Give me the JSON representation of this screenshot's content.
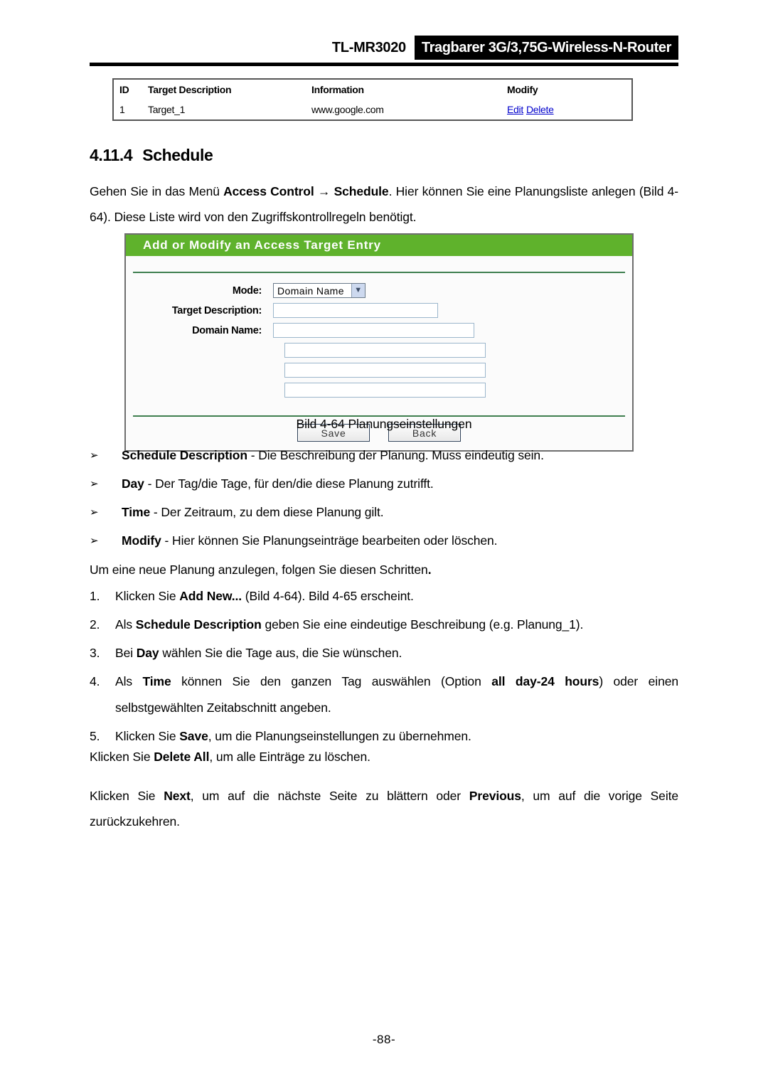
{
  "header": {
    "model": "TL-MR3020",
    "product": "Tragbarer 3G/3,75G-Wireless-N-Router"
  },
  "target_table": {
    "columns": [
      "ID",
      "Target Description",
      "Information",
      "Modify"
    ],
    "rows": [
      {
        "id": "1",
        "description": "Target_1",
        "information": "www.google.com",
        "edit_label": "Edit",
        "delete_label": "Delete"
      }
    ],
    "link_color": "#0000cc"
  },
  "section": {
    "number": "4.11.4",
    "title": "Schedule"
  },
  "intro": {
    "part1": "Gehen Sie in das Menü ",
    "bold1": "Access Control",
    "arrow": " → ",
    "bold2": "Schedule",
    "part2": ". Hier können Sie eine Planungsliste anlegen (Bild 4-64). Diese Liste wird von den Zugriffskontrollregeln benötigt."
  },
  "router_panel": {
    "title": "Add or Modify an Access Target Entry",
    "accent_color": "#5fb22c",
    "divider_color": "#3f7f4f",
    "fields": {
      "mode_label": "Mode:",
      "mode_value": "Domain Name",
      "mode_arrow": "▼",
      "target_description_label": "Target Description:",
      "target_description_value": "",
      "domain_name_label": "Domain Name:",
      "domain_name_value_1": "",
      "domain_name_value_2": "",
      "domain_name_value_3": "",
      "domain_name_value_4": ""
    },
    "buttons": {
      "save": "Save",
      "back": "Back"
    }
  },
  "caption": "Bild 4-64 Planungseinstellungen",
  "bullets": [
    {
      "glyph": "➢",
      "bold": "Schedule Description",
      "text": " - Die Beschreibung der Planung. Muss eindeutig sein."
    },
    {
      "glyph": "➢",
      "bold": "Day",
      "text": " - Der Tag/die Tage, für den/die diese Planung zutrifft."
    },
    {
      "glyph": "➢",
      "bold": "Time",
      "text": " - Der Zeitraum, zu dem diese Planung gilt."
    },
    {
      "glyph": "➢",
      "bold": "Modify",
      "text": " - Hier können Sie Planungseinträge bearbeiten oder löschen."
    }
  ],
  "mid_paragraph": {
    "text": "Um eine neue Planung anzulegen, folgen Sie diesen Schritten",
    "period": "."
  },
  "steps": [
    {
      "num": "1.",
      "pre": "Klicken Sie ",
      "bold": "Add New...",
      "post": " (Bild 4-64). Bild 4-65 erscheint."
    },
    {
      "num": "2.",
      "pre": "Als ",
      "bold": "Schedule Description",
      "post": " geben Sie eine eindeutige Beschreibung (e.g. Planung_1)."
    },
    {
      "num": "3.",
      "pre": "Bei ",
      "bold": "Day",
      "post": " wählen Sie die Tage aus, die Sie wünschen."
    },
    {
      "num": "4.",
      "pre": "Als ",
      "bold": "Time",
      "post": " können Sie den ganzen Tag auswählen (Option ",
      "bold2": "all day-24 hours",
      "post2": ") oder einen selbstgewählten Zeitabschnitt angeben."
    },
    {
      "num": "5.",
      "pre": "Klicken Sie ",
      "bold": "Save",
      "post": ", um die Planungseinstellungen zu übernehmen."
    }
  ],
  "closing": [
    {
      "pre": "Klicken Sie ",
      "bold": "Delete All",
      "post": ", um alle Einträge zu löschen."
    },
    {
      "pre": "Klicken Sie ",
      "bold": "Next",
      "mid": ", um auf die nächste Seite zu blättern oder ",
      "bold2": "Previous",
      "post": ", um auf die vorige Seite zurückzukehren."
    }
  ],
  "page_number": "-88-"
}
